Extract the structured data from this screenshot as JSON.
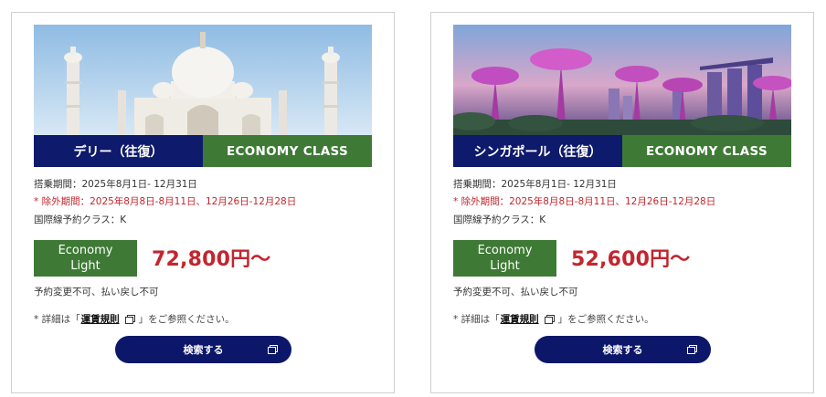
{
  "cards": [
    {
      "destination": "デリー（往復）",
      "class_label": "ECONOMY CLASS",
      "travel_period": "搭乗期間：2025年8月1日- 12月31日",
      "blackout": "* 除外期間：2025年8月8日-8月11日、12月26日-12月28日",
      "booking_class": "国際線予約クラス：K",
      "fare_line1": "Economy",
      "fare_line2": "Light",
      "price": "72,800円～",
      "condition": "予約変更不可、払い戻し不可",
      "detail_prefix": "*  詳細は「",
      "detail_link": "運賃規則",
      "detail_suffix": "」をご参照ください。",
      "search_label": "検索する",
      "photo_icon": "taj-mahal-photo"
    },
    {
      "destination": "シンガポール（往復）",
      "class_label": "ECONOMY CLASS",
      "travel_period": "搭乗期間：2025年8月1日- 12月31日",
      "blackout": "* 除外期間：2025年8月8日-8月11日、12月26日-12月28日",
      "booking_class": "国際線予約クラス：K",
      "fare_line1": "Economy",
      "fare_line2": "Light",
      "price": "52,600円～",
      "condition": "予約変更不可、払い戻し不可",
      "detail_prefix": "*  詳細は「",
      "detail_link": "運賃規則",
      "detail_suffix": "」をご参照ください。",
      "search_label": "検索する",
      "photo_icon": "gardens-by-the-bay-photo"
    }
  ],
  "colors": {
    "navy": "#0e1a6b",
    "green": "#3e7a35",
    "red": "#c2262e"
  }
}
